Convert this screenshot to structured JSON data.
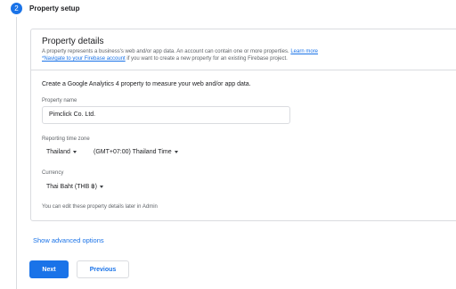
{
  "step": {
    "number": "2",
    "title": "Property setup"
  },
  "card": {
    "title": "Property details",
    "desc_line1": "A property represents a business's web and/or app data. An account can contain one or more properties.",
    "learn_more": "Learn more",
    "firebase_link": "*Navigate to your Firebase account",
    "desc_line2_rest": " if you want to create a new property for an existing Firebase project.",
    "intro": "Create a Google Analytics 4 property to measure your web and/or app data."
  },
  "form": {
    "property_name_label": "Property name",
    "property_name_value": "Pimclick Co. Ltd.",
    "timezone_label": "Reporting time zone",
    "country_value": "Thailand",
    "timezone_value": "(GMT+07:00) Thailand Time",
    "currency_label": "Currency",
    "currency_value": "Thai Baht (THB ฿)",
    "hint": "You can edit these property details later in Admin"
  },
  "actions": {
    "advanced": "Show advanced options",
    "next": "Next",
    "previous": "Previous"
  },
  "colors": {
    "accent": "#1a73e8",
    "border": "#dadce0"
  }
}
